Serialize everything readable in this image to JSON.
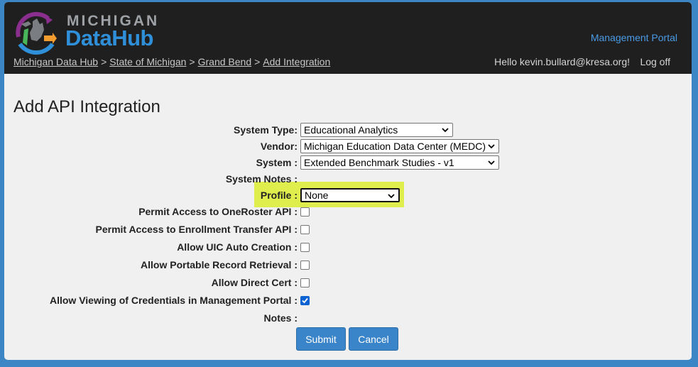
{
  "header": {
    "logo_line1": "MICHIGAN",
    "logo_line2": "DataHub",
    "management_portal": "Management Portal",
    "breadcrumbs": [
      "Michigan Data Hub",
      "State of Michigan",
      "Grand Bend",
      "Add Integration"
    ],
    "breadcrumb_sep": ">",
    "hello": "Hello kevin.bullard@kresa.org!",
    "logoff": "Log off"
  },
  "page_title": "Add API Integration",
  "form": {
    "system_type_label": "System Type:",
    "system_type_value": "Educational Analytics",
    "vendor_label": "Vendor:",
    "vendor_value": "Michigan Education Data Center (MEDC)",
    "system_label": "System :",
    "system_value": "Extended Benchmark Studies - v1",
    "system_notes_label": "System Notes :",
    "profile_label": "Profile :",
    "profile_value": "None",
    "oneroster_label": "Permit Access to OneRoster API :",
    "oneroster_checked": false,
    "enrollment_label": "Permit Access to Enrollment Transfer API :",
    "enrollment_checked": false,
    "uic_label": "Allow UIC Auto Creation :",
    "uic_checked": false,
    "portable_label": "Allow Portable Record Retrieval :",
    "portable_checked": false,
    "directcert_label": "Allow Direct Cert :",
    "directcert_checked": false,
    "credentials_label": "Allow Viewing of Credentials in Management Portal :",
    "credentials_checked": true,
    "notes_label": "Notes :",
    "submit_label": "Submit",
    "cancel_label": "Cancel"
  },
  "colors": {
    "background": "#3d86c6",
    "header": "#1f1f1f",
    "highlight": "#dfee4d",
    "button": "#3a84c9",
    "link": "#4a9be6"
  }
}
